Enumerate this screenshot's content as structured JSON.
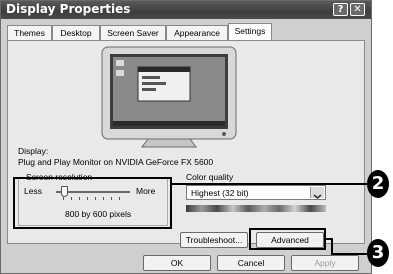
{
  "window": {
    "title": "Display Properties",
    "help_glyph": "?",
    "close_glyph": "✕"
  },
  "tabs": [
    {
      "label": "Themes"
    },
    {
      "label": "Desktop"
    },
    {
      "label": "Screen Saver"
    },
    {
      "label": "Appearance"
    },
    {
      "label": "Settings"
    }
  ],
  "display": {
    "label": "Display:",
    "value": "Plug and Play Monitor on NVIDIA GeForce FX 5600"
  },
  "resolution": {
    "label": "Screen resolution",
    "less": "Less",
    "more": "More",
    "value": "800 by 600 pixels",
    "slider_level": 0.08
  },
  "color_quality": {
    "label": "Color quality",
    "selected": "Highest (32 bit)"
  },
  "buttons": {
    "troubleshoot": "Troubleshoot...",
    "advanced": "Advanced",
    "ok": "OK",
    "cancel": "Cancel",
    "apply": "Apply"
  },
  "callouts": {
    "first": "2",
    "second": "3"
  }
}
